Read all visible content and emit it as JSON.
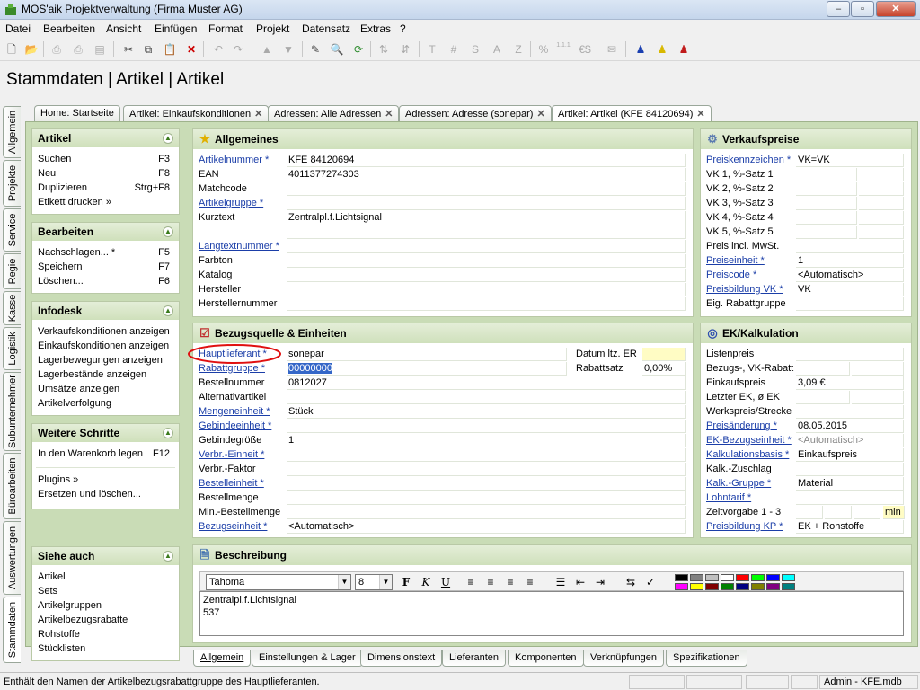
{
  "window": {
    "title": "MOS'aik Projektverwaltung (Firma Muster AG)",
    "minimize": "–",
    "maximize": "▫",
    "close": "✕"
  },
  "menu": [
    "Datei",
    "Bearbeiten",
    "Ansicht",
    "Einfügen",
    "Format",
    "Projekt",
    "Datensatz",
    "Extras",
    "?"
  ],
  "toolbar": {
    "text_buttons": [
      "T",
      "#",
      "S",
      "A",
      "Z",
      "%"
    ],
    "euro_button": "€$",
    "small_digits": "1.1.1"
  },
  "header": {
    "title": "Stammdaten | Artikel | Artikel"
  },
  "doc_tabs": [
    {
      "label": "Home: Startseite",
      "closable": false
    },
    {
      "label": "Artikel: Einkaufskonditionen",
      "closable": true
    },
    {
      "label": "Adressen: Alle Adressen",
      "closable": true
    },
    {
      "label": "Adressen: Adresse (sonepar)",
      "closable": true
    },
    {
      "label": "Artikel: Artikel (KFE 84120694)",
      "closable": true
    }
  ],
  "vertical_tabs": [
    "Allgemein",
    "Projekte",
    "Service",
    "Regie",
    "Kasse",
    "Logistik",
    "Subunternehmer",
    "Büroarbeiten",
    "Auswertungen",
    "Stammdaten"
  ],
  "sidebar": {
    "artikel": {
      "title": "Artikel",
      "items": [
        {
          "label": "Suchen",
          "key": "F3"
        },
        {
          "label": "Neu",
          "key": "F8"
        },
        {
          "label": "Duplizieren",
          "key": "Strg+F8"
        },
        {
          "label": "Etikett drucken »",
          "key": ""
        }
      ]
    },
    "bearbeiten": {
      "title": "Bearbeiten",
      "items": [
        {
          "label": "Nachschlagen... *",
          "key": "F5"
        },
        {
          "label": "Speichern",
          "key": "F7"
        },
        {
          "label": "Löschen...",
          "key": "F6"
        }
      ]
    },
    "infodesk": {
      "title": "Infodesk",
      "items": [
        {
          "label": "Verkaufskonditionen anzeigen"
        },
        {
          "label": "Einkaufskonditionen anzeigen"
        },
        {
          "label": "Lagerbewegungen anzeigen"
        },
        {
          "label": "Lagerbestände anzeigen"
        },
        {
          "label": "Umsätze anzeigen"
        },
        {
          "label": "Artikelverfolgung"
        }
      ]
    },
    "weitere": {
      "title": "Weitere Schritte",
      "items": [
        {
          "label": "In den Warenkorb legen",
          "key": "F12"
        },
        {
          "label": "Plugins »",
          "key": ""
        },
        {
          "label": "Ersetzen und löschen...",
          "key": ""
        }
      ]
    },
    "siehe": {
      "title": "Siehe auch",
      "items": [
        "Artikel",
        "Sets",
        "Artikelgruppen",
        "Artikelbezugsrabatte",
        "Rohstoffe",
        "Stücklisten"
      ]
    }
  },
  "allgemeines": {
    "title": "Allgemeines",
    "rows": [
      {
        "label": "Artikelnummer *",
        "link": true,
        "value": "KFE 84120694"
      },
      {
        "label": "EAN",
        "link": false,
        "value": "4011377274303"
      },
      {
        "label": "Matchcode",
        "link": false,
        "value": ""
      },
      {
        "label": "Artikelgruppe *",
        "link": true,
        "value": ""
      },
      {
        "label": "Kurztext",
        "link": false,
        "value": "Zentralpl.f.Lichtsignal"
      },
      {
        "label": "Langtextnummer *",
        "link": true,
        "value": ""
      },
      {
        "label": "Farbton",
        "link": false,
        "value": ""
      },
      {
        "label": "Katalog",
        "link": false,
        "value": ""
      },
      {
        "label": "Hersteller",
        "link": false,
        "value": ""
      },
      {
        "label": "Herstellernummer",
        "link": false,
        "value": ""
      }
    ]
  },
  "verkaufspreise": {
    "title": "Verkaufspreise",
    "rows": [
      {
        "label": "Preiskennzeichen *",
        "link": true,
        "value": "VK=VK"
      },
      {
        "label": "VK 1, %-Satz 1",
        "link": false,
        "value": ""
      },
      {
        "label": "VK 2, %-Satz 2",
        "link": false,
        "value": ""
      },
      {
        "label": "VK 3, %-Satz 3",
        "link": false,
        "value": ""
      },
      {
        "label": "VK 4, %-Satz 4",
        "link": false,
        "value": ""
      },
      {
        "label": "VK 5, %-Satz 5",
        "link": false,
        "value": ""
      },
      {
        "label": "Preis incl. MwSt.",
        "link": false,
        "value": ""
      },
      {
        "label": "Preiseinheit *",
        "link": true,
        "value": "1"
      },
      {
        "label": "Preiscode *",
        "link": true,
        "value": "<Automatisch>"
      },
      {
        "label": "Preisbildung VK *",
        "link": true,
        "value": "VK"
      },
      {
        "label": "Eig. Rabattgruppe",
        "link": false,
        "value": ""
      }
    ]
  },
  "bezugsquelle": {
    "title": "Bezugsquelle & Einheiten",
    "rows": [
      {
        "label": "Hauptlieferant *",
        "link": true,
        "value": "sonepar"
      },
      {
        "label": "Rabattgruppe *",
        "link": true,
        "value": "00000000"
      },
      {
        "label": "Bestellnummer",
        "link": false,
        "value": "0812027"
      },
      {
        "label": "Alternativartikel",
        "link": false,
        "value": ""
      },
      {
        "label": "Mengeneinheit *",
        "link": true,
        "value": "Stück"
      },
      {
        "label": "Gebindeeinheit *",
        "link": true,
        "value": ""
      },
      {
        "label": "Gebindegröße",
        "link": false,
        "value": "1"
      },
      {
        "label": "Verbr.-Einheit *",
        "link": true,
        "value": ""
      },
      {
        "label": "Verbr.-Faktor",
        "link": false,
        "value": ""
      },
      {
        "label": "Bestelleinheit *",
        "link": true,
        "value": ""
      },
      {
        "label": "Bestellmenge",
        "link": false,
        "value": ""
      },
      {
        "label": "Min.-Bestellmenge",
        "link": false,
        "value": ""
      },
      {
        "label": "Bezugseinheit *",
        "link": true,
        "value": "<Automatisch>"
      }
    ],
    "datum_label": "Datum ltz. ER",
    "datum_value": "",
    "rabattsatz_label": "Rabattsatz",
    "rabattsatz_value": "0,00%"
  },
  "ek": {
    "title": "EK/Kalkulation",
    "rows": [
      {
        "label": "Listenpreis",
        "link": false,
        "value": ""
      },
      {
        "label": "Bezugs-, VK-Rabatt",
        "link": false,
        "value": ""
      },
      {
        "label": "Einkaufspreis",
        "link": false,
        "value": "3,09 €"
      },
      {
        "label": "Letzter EK, ø EK",
        "link": false,
        "value": ""
      },
      {
        "label": "Werkspreis/Strecke",
        "link": false,
        "value": ""
      },
      {
        "label": "Preisänderung *",
        "link": true,
        "value": "08.05.2015"
      },
      {
        "label": "EK-Bezugseinheit *",
        "link": true,
        "value": "<Automatisch>"
      },
      {
        "label": "Kalkulationsbasis *",
        "link": true,
        "value": "Einkaufspreis"
      },
      {
        "label": "Kalk.-Zuschlag",
        "link": false,
        "value": ""
      },
      {
        "label": "Kalk.-Gruppe *",
        "link": true,
        "value": "Material"
      },
      {
        "label": "Lohntarif *",
        "link": true,
        "value": ""
      },
      {
        "label": "Zeitvorgabe 1 - 3",
        "link": false,
        "value": ""
      },
      {
        "label": "Preisbildung KP *",
        "link": true,
        "value": "EK + Rohstoffe"
      }
    ],
    "min_label": "min"
  },
  "beschreibung": {
    "title": "Beschreibung",
    "font": "Tahoma",
    "size": "8",
    "lines": [
      "Zentralpl.f.Lichtsignal",
      "537"
    ],
    "format_bold": "F",
    "format_italic": "K",
    "format_underline": "U",
    "swatches_top": [
      "#000000",
      "#808080",
      "#c0c0c0",
      "#ffffff",
      "#ff0000",
      "#00ff00",
      "#0000ff",
      "#00ffff"
    ],
    "swatches_bottom": [
      "#ff00ff",
      "#ffff00",
      "#800000",
      "#008000",
      "#000080",
      "#808000",
      "#800080",
      "#008080"
    ]
  },
  "bottom_tabs": [
    "Allgemein",
    "Einstellungen & Lager",
    "Dimensionstext",
    "Lieferanten",
    "Komponenten",
    "Verknüpfungen",
    "Spezifikationen"
  ],
  "status": {
    "text": "Enthält den Namen der Artikelbezugsrabattgruppe des Hauptlieferanten.",
    "user": "Admin - KFE.mdb"
  }
}
